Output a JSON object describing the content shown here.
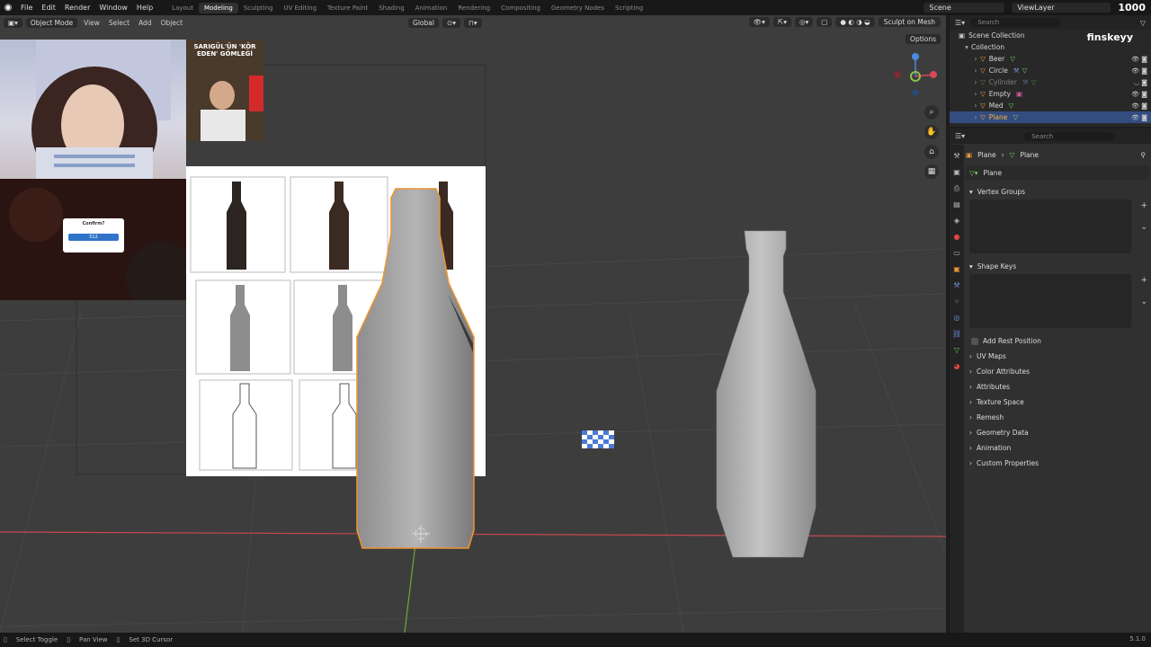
{
  "topbar": {
    "menus": [
      "File",
      "Edit",
      "Render",
      "Window",
      "Help"
    ],
    "workspaces": [
      "Layout",
      "Modeling",
      "Sculpting",
      "UV Editing",
      "Texture Paint",
      "Shading",
      "Animation",
      "Rendering",
      "Compositing",
      "Geometry Nodes",
      "Scripting"
    ],
    "active_workspace": "Modeling",
    "scene": "Scene",
    "view_layer": "ViewLayer",
    "viewer_count": "1000"
  },
  "viewport_header": {
    "mode": "Object Mode",
    "menus": [
      "View",
      "Select",
      "Add",
      "Object"
    ],
    "orientation": "Global",
    "sculpt_on_mesh": "Sculpt on Mesh",
    "options": "Options"
  },
  "overlays": {
    "news_headline": "SARIGÜL'ÜN 'KÖR EDEN' GÖMLEĞİ",
    "game_popup_title": "Confirm?",
    "game_popup_button": "512"
  },
  "outliner": {
    "search_placeholder": "Search",
    "root": "Scene Collection",
    "collection": "Collection",
    "items": [
      {
        "name": "Beer",
        "state": "normal"
      },
      {
        "name": "Circle",
        "state": "normal"
      },
      {
        "name": "Cylinder",
        "state": "hidden"
      },
      {
        "name": "Empty",
        "state": "normal"
      },
      {
        "name": "Med",
        "state": "normal"
      },
      {
        "name": "Plane",
        "state": "selected"
      }
    ]
  },
  "brand": "finskeyy",
  "properties": {
    "search_placeholder": "Search",
    "breadcrumb_object": "Plane",
    "breadcrumb_mesh": "Plane",
    "mesh_name": "Plane",
    "vertex_groups": "Vertex Groups",
    "shape_keys": "Shape Keys",
    "add_rest_position": "Add Rest Position",
    "panels": [
      "UV Maps",
      "Color Attributes",
      "Attributes",
      "Texture Space",
      "Remesh",
      "Geometry Data",
      "Animation",
      "Custom Properties"
    ]
  },
  "statusbar": {
    "items": [
      "Select Toggle",
      "Pan View",
      "Set 3D Cursor"
    ],
    "version": "5.1.0"
  },
  "colors": {
    "selection_outline": "#f0942e",
    "axis_x": "#c8484e",
    "axis_y": "#6fa832",
    "selected_row": "#334d80"
  }
}
